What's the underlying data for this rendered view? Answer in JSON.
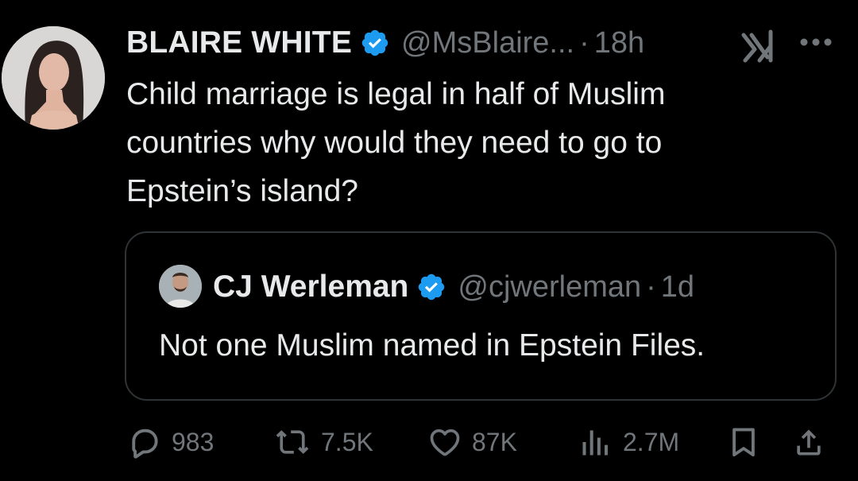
{
  "tweet": {
    "author": {
      "display_name": "BLAIRE WHITE",
      "handle": "@MsBlaire...",
      "verified": true,
      "avatar": "profile-photo"
    },
    "separator": "·",
    "time": "18h",
    "icons": {
      "grok": "grok-icon",
      "more": "more-options-icon"
    },
    "text": "Child marriage is legal in half of Muslim\ncountries why would they need to go to\nEpstein’s island?"
  },
  "quoted_tweet": {
    "author": {
      "display_name": "CJ Werleman",
      "handle": "@cjwerleman",
      "verified": true,
      "avatar": "profile-photo"
    },
    "separator": "·",
    "time": "1d",
    "text": "Not one Muslim named in Epstein Files."
  },
  "actions": {
    "reply": {
      "icon": "reply-icon",
      "count": "983"
    },
    "repost": {
      "icon": "repost-icon",
      "count": "7.5K"
    },
    "like": {
      "icon": "heart-icon",
      "count": "87K"
    },
    "views": {
      "icon": "views-icon",
      "count": "2.7M"
    },
    "bookmark": {
      "icon": "bookmark-icon"
    },
    "share": {
      "icon": "share-icon"
    }
  },
  "colors": {
    "background": "#000000",
    "primary_text": "#e7e9ea",
    "secondary_text": "#71767b",
    "verified_blue": "#1d9bf0",
    "border": "#2f3336"
  }
}
